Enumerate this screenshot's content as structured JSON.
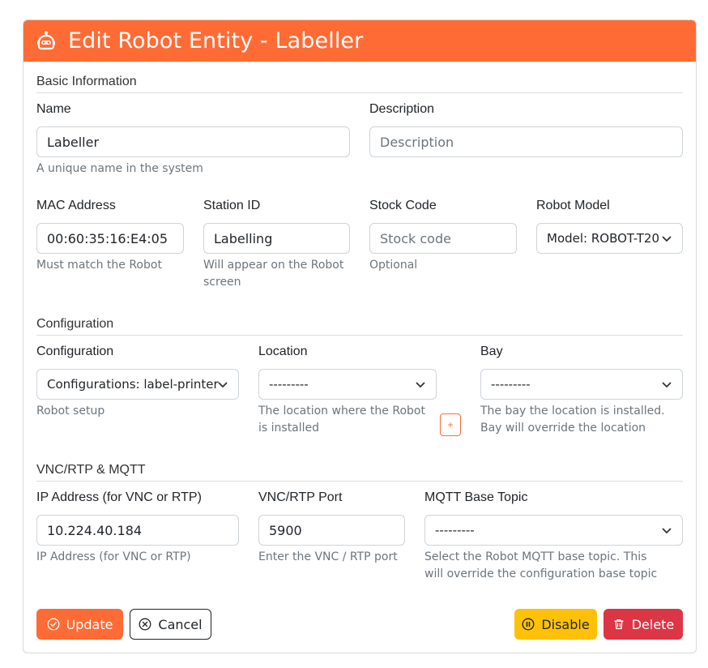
{
  "header": {
    "title": "Edit Robot Entity - Labeller",
    "icon": "robot-icon",
    "color": "#ff6b35"
  },
  "basic": {
    "section_title": "Basic Information",
    "name": {
      "label": "Name",
      "value": "Labeller",
      "help": "A unique name in the system"
    },
    "description": {
      "label": "Description",
      "placeholder": "Description"
    },
    "mac": {
      "label": "MAC Address",
      "value": "00:60:35:16:E4:05",
      "help": "Must match the Robot"
    },
    "station": {
      "label": "Station ID",
      "value": "Labelling",
      "help": "Will appear on the Robot screen"
    },
    "stock": {
      "label": "Stock Code",
      "placeholder": "Stock code",
      "help": "Optional"
    },
    "model": {
      "label": "Robot Model",
      "value": "Model: ROBOT-T20"
    }
  },
  "config": {
    "section_title": "Configuration",
    "configuration": {
      "label": "Configuration",
      "value": "Configurations: label-printer",
      "help": "Robot setup"
    },
    "location": {
      "label": "Location",
      "value": "---------",
      "help": "The location where the Robot is installed",
      "add_label": "+"
    },
    "bay": {
      "label": "Bay",
      "value": "---------",
      "help": "The bay the location is installed. Bay will override the location"
    }
  },
  "vnc": {
    "section_title": "VNC/RTP & MQTT",
    "ip": {
      "label": "IP Address (for VNC or RTP)",
      "value": "10.224.40.184",
      "help": "IP Address (for VNC or RTP)"
    },
    "port": {
      "label": "VNC/RTP Port",
      "value": "5900",
      "help": "Enter the VNC / RTP port"
    },
    "mqtt": {
      "label": "MQTT Base Topic",
      "value": "---------",
      "help": "Select the Robot MQTT base topic. This will override the configuration base topic"
    }
  },
  "actions": {
    "update": "Update",
    "cancel": "Cancel",
    "disable": "Disable",
    "delete": "Delete"
  },
  "colors": {
    "primary": "#ff6b35",
    "warning": "#ffc107",
    "danger": "#dc3545"
  }
}
